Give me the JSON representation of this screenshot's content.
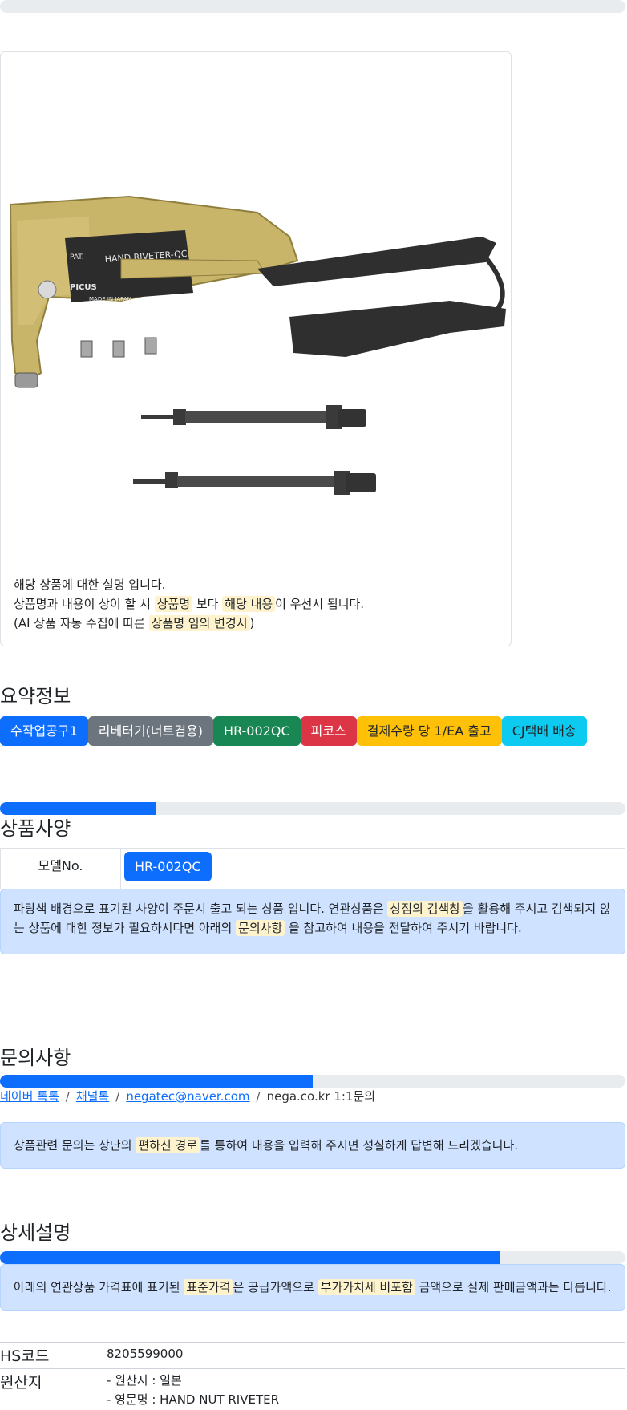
{
  "product_card": {
    "image_label": "HAND RIVETER-QC",
    "image_brand": "PICUS",
    "image_made_in": "MADE IN JAPAN",
    "image_pat": "PAT.",
    "desc_line1": "해당 상품에 대한 설명 입니다.",
    "desc_line2_a": "상품명과 내용이 상이 할 시 ",
    "desc_line2_mark1": "상품명",
    "desc_line2_b": " 보다 ",
    "desc_line2_mark2": "해당 내용",
    "desc_line2_c": "이 우선시 됩니다.",
    "desc_line3_a": "(AI 상품 자동 수집에 따른 ",
    "desc_line3_mark": "상품명 임의 변경시",
    "desc_line3_b": ")"
  },
  "summary": {
    "title": "요약정보",
    "badges": [
      {
        "label": "수작업공구1",
        "color": "#0d6efd",
        "text": "#ffffff"
      },
      {
        "label": "리베터기(너트겸용)",
        "color": "#6c757d",
        "text": "#ffffff"
      },
      {
        "label": "HR-002QC",
        "color": "#198754",
        "text": "#ffffff"
      },
      {
        "label": "피코스",
        "color": "#dc3545",
        "text": "#ffffff"
      },
      {
        "label": "결제수량 당 1/EA 출고",
        "color": "#ffc107",
        "text": "#212529"
      },
      {
        "label": "CJ택배 배송",
        "color": "#0dcaf0",
        "text": "#212529"
      }
    ]
  },
  "specs": {
    "title": "상품사양",
    "progress": 0.25,
    "row_label": "모델No.",
    "row_value": "HR-002QC",
    "alert_a": "파랑색 배경으로 표기된 사양이 주문시 출고 되는 상품 입니다. 연관상품은 ",
    "alert_mark1": "상점의 검색창",
    "alert_b": "을 활용해 주시고 검색되지 않는 상품에 대한 정보가 필요하시다면 아래의 ",
    "alert_mark2": "문의사항",
    "alert_c": " 을 참고하여 내용을 전달하여 주시기 바랍니다."
  },
  "inquiry": {
    "title": "문의사항",
    "progress": 0.5,
    "link1": "네이버 톡톡",
    "link2": "채널톡",
    "link3": "negatec@naver.com",
    "plain": "nega.co.kr 1:1문의",
    "sep": "/",
    "alert_a": "상품관련 문의는 상단의 ",
    "alert_mark": "편하신 경로",
    "alert_b": "를 통하여 내용을 입력해 주시면 성실하게 답변해 드리겠습니다."
  },
  "detail": {
    "title": "상세설명",
    "progress": 0.8,
    "alert_a": "아래의 연관상품 가격표에 표기된 ",
    "alert_mark1": "표준가격",
    "alert_b": "은 공급가액으로 ",
    "alert_mark2": "부가가치세 비포함",
    "alert_c": " 금액으로 실제 판매금액과는 다릅니다.",
    "hs_label": "HS코드",
    "hs_value": "8205599000",
    "origin_label": "원산지",
    "origin_line1": "- 원산지 : 일본",
    "origin_line2": "- 영문명 : HAND NUT RIVETER"
  }
}
